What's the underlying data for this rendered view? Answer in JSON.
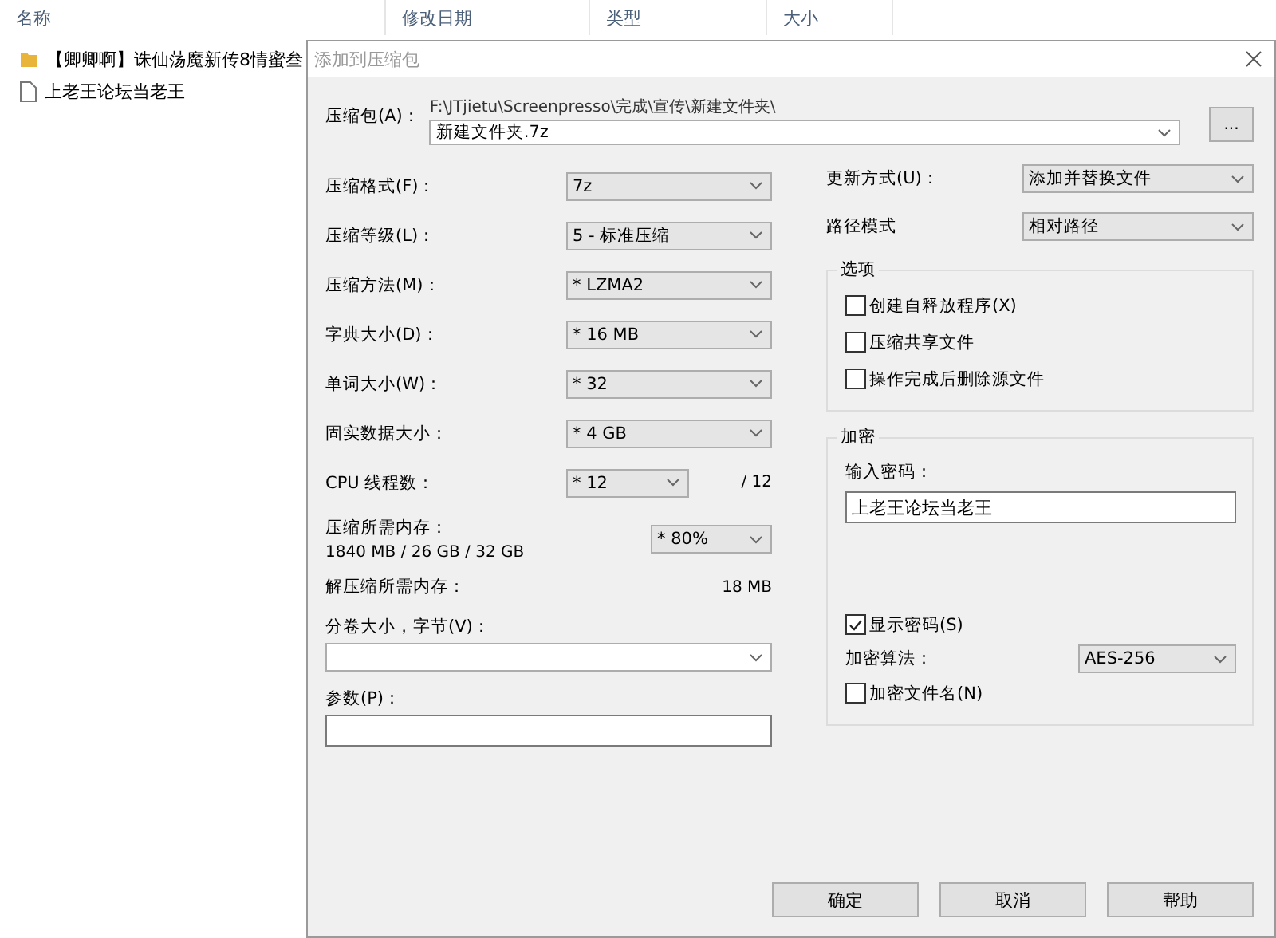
{
  "explorer": {
    "columns": [
      "名称",
      "修改日期",
      "类型",
      "大小"
    ],
    "files": [
      {
        "kind": "folder",
        "name": "【卿卿啊】诛仙荡魔新传8情蜜叁"
      },
      {
        "kind": "file",
        "name": "上老王论坛当老王"
      }
    ]
  },
  "dialog": {
    "title": "添加到压缩包",
    "archive": {
      "label": "压缩包(A)：",
      "path": "F:\\JTjietu\\Screenpresso\\完成\\宣传\\新建文件夹\\",
      "value": "新建文件夹.7z",
      "browse": "..."
    },
    "settings": [
      {
        "label": "压缩格式(F)：",
        "value": "7z"
      },
      {
        "label": "压缩等级(L)：",
        "value": "5 - 标准压缩"
      },
      {
        "label": "压缩方法(M)：",
        "value": "* LZMA2"
      },
      {
        "label": "字典大小(D)：",
        "value": "* 16 MB"
      },
      {
        "label": "单词大小(W)：",
        "value": "* 32"
      },
      {
        "label": "固实数据大小：",
        "value": "* 4 GB"
      }
    ],
    "cpu": {
      "label": "CPU 线程数：",
      "value": "* 12",
      "max": "/ 12"
    },
    "memory": {
      "label": "压缩所需内存：",
      "usage": "1840 MB / 26 GB / 32 GB",
      "value": "* 80%"
    },
    "decompress_memory": {
      "label": "解压缩所需内存：",
      "value": "18 MB"
    },
    "volume": {
      "label": "分卷大小，字节(V)："
    },
    "parameters": {
      "label": "参数(P)："
    },
    "update_mode": {
      "label": "更新方式(U)：",
      "value": "添加并替换文件"
    },
    "path_mode": {
      "label": "路径模式",
      "value": "相对路径"
    },
    "options": {
      "title": "选项",
      "items": [
        {
          "label": "创建自释放程序(X)",
          "checked": false
        },
        {
          "label": "压缩共享文件",
          "checked": false
        },
        {
          "label": "操作完成后删除源文件",
          "checked": false
        }
      ]
    },
    "encryption": {
      "title": "加密",
      "password_label": "输入密码：",
      "password": "上老王论坛当老王",
      "show_password": {
        "label": "显示密码(S)",
        "checked": true
      },
      "method": {
        "label": "加密算法：",
        "value": "AES-256"
      },
      "encrypt_names": {
        "label": "加密文件名(N)",
        "checked": false
      }
    },
    "buttons": [
      "确定",
      "取消",
      "帮助"
    ]
  }
}
